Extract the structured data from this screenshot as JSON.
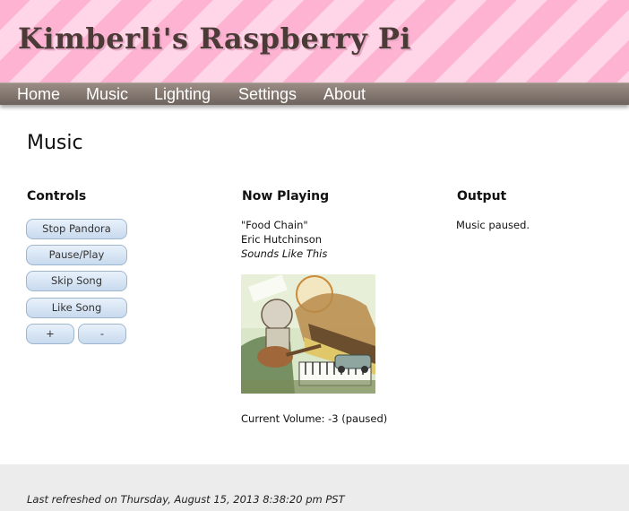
{
  "header": {
    "title": "Kimberli's Raspberry Pi"
  },
  "nav": {
    "items": [
      {
        "label": "Home"
      },
      {
        "label": "Music"
      },
      {
        "label": "Lighting"
      },
      {
        "label": "Settings"
      },
      {
        "label": "About"
      }
    ]
  },
  "main": {
    "page_title": "Music",
    "controls": {
      "heading": "Controls",
      "stop_label": "Stop Pandora",
      "pause_label": "Pause/Play",
      "skip_label": "Skip Song",
      "like_label": "Like Song",
      "vol_up_label": "+",
      "vol_down_label": "-"
    },
    "now_playing": {
      "heading": "Now Playing",
      "song": "\"Food Chain\"",
      "artist": "Eric Hutchinson",
      "album": "Sounds Like This",
      "volume": "Current Volume: -3 (paused)"
    },
    "output": {
      "heading": "Output",
      "text": "Music paused."
    }
  },
  "footer": {
    "refreshed": "Last refreshed on Thursday, August 15, 2013 8:38:20 pm PST"
  },
  "colors": {
    "header_stripe_1": "#ffb3d2",
    "header_stripe_2": "#ffd6e7",
    "title_text": "#4a3b37",
    "nav_bg": "#6e635d",
    "button_bg": "#c8daee",
    "footer_bg": "#ececec"
  }
}
